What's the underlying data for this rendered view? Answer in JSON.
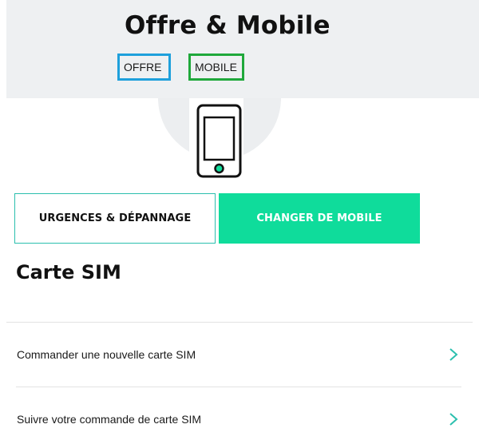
{
  "header": {
    "title": "Offre & Mobile",
    "tags": [
      {
        "label": "OFFRE",
        "color": "#1ea0dc"
      },
      {
        "label": "MOBILE",
        "color": "#1fa83b"
      }
    ]
  },
  "illustration": {
    "icon": "smartphone-icon",
    "accent": "#0fdc9b"
  },
  "actions": {
    "urgences_label": "URGENCES & DÉPANNAGE",
    "changer_label": "CHANGER DE MOBILE",
    "primary_color": "#0fdc9b"
  },
  "sim_section": {
    "title": "Carte SIM",
    "items": [
      {
        "label": "Commander une nouvelle carte SIM",
        "icon": "chevron-right-icon"
      },
      {
        "label": "Suivre votre commande de carte SIM",
        "icon": "chevron-right-icon"
      }
    ],
    "chevron_color": "#2bbfae"
  }
}
